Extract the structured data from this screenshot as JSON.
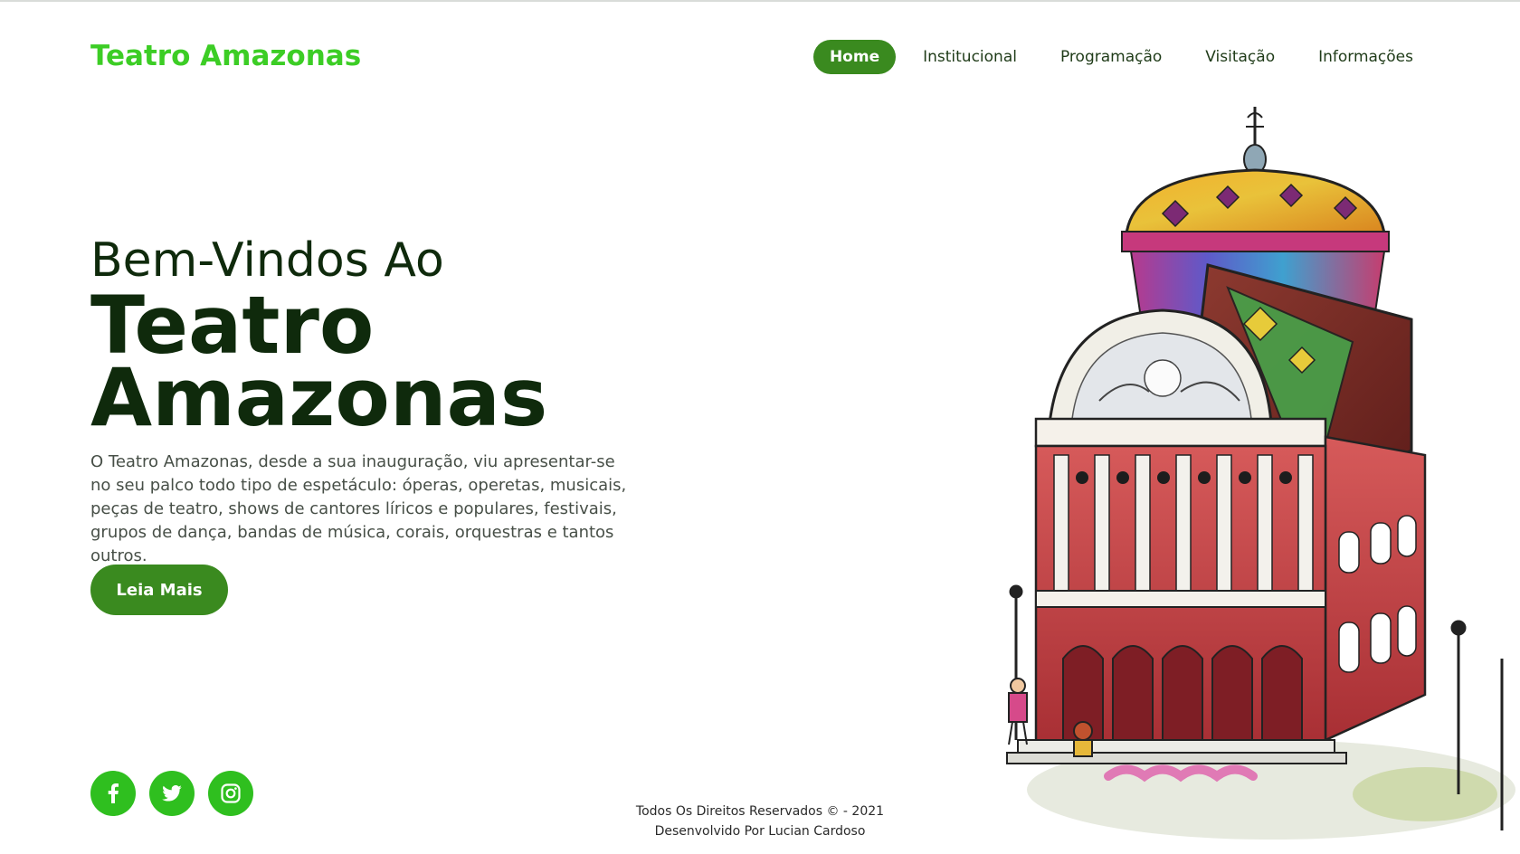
{
  "brand": {
    "name": "Teatro Amazonas"
  },
  "nav": {
    "items": [
      {
        "label": "Home",
        "active": true
      },
      {
        "label": "Institucional",
        "active": false
      },
      {
        "label": "Programação",
        "active": false
      },
      {
        "label": "Visitação",
        "active": false
      },
      {
        "label": "Informações",
        "active": false
      }
    ]
  },
  "hero": {
    "subtitle": "Bem-Vindos Ao",
    "title_line1": "Teatro",
    "title_line2": "Amazonas",
    "text": "O Teatro Amazonas, desde a sua inauguração, viu apresentar-se no seu palco todo tipo de espetáculo: óperas, operetas, musicais, peças de teatro, shows de cantores líricos e populares, festivais, grupos de dança, bandas de música, corais, orquestras e tantos outros.",
    "cta_label": "Leia Mais"
  },
  "socials": {
    "items": [
      {
        "icon": "facebook-icon"
      },
      {
        "icon": "twitter-icon"
      },
      {
        "icon": "instagram-icon"
      }
    ]
  },
  "footer": {
    "rights": "Todos Os Direitos Reservados © - 2021",
    "credit": "Desenvolvido Por Lucian Cardoso"
  },
  "colors": {
    "brand_green": "#3ccd25",
    "button_green": "#3a8a1f",
    "social_green": "#2fbf1f",
    "heading_dark": "#0f2a0c"
  }
}
